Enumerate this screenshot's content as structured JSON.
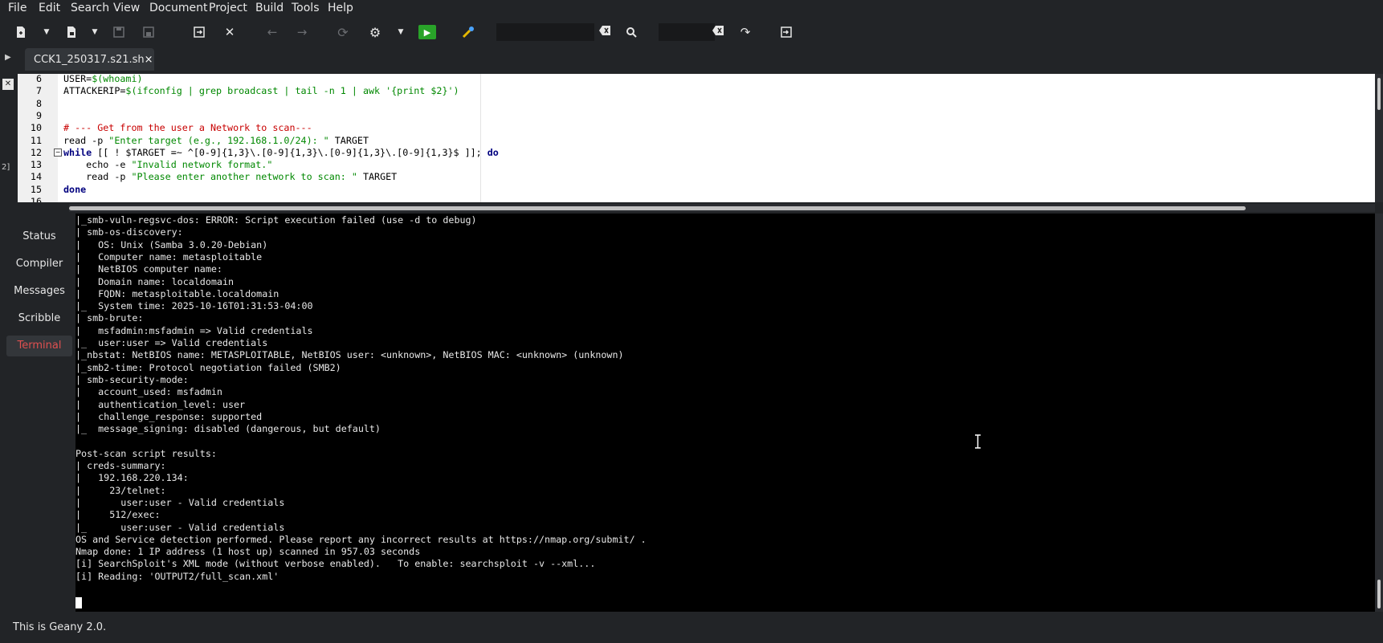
{
  "menu": [
    "File",
    "Edit",
    "Search",
    "View",
    "Document",
    "Project",
    "Build",
    "Tools",
    "Help"
  ],
  "toolbar": {
    "search_value": "",
    "goto_value": ""
  },
  "tab": {
    "label": "CCK1_250317.s21.sh",
    "close": "×"
  },
  "strip": {
    "num": "2]"
  },
  "editor": {
    "lines": [
      {
        "n": "6",
        "parts": [
          [
            "op",
            "USER="
          ],
          [
            "st",
            "$(whoami)"
          ]
        ]
      },
      {
        "n": "7",
        "parts": [
          [
            "op",
            "ATTACKERIP="
          ],
          [
            "st",
            "$(ifconfig | grep broadcast | tail -n 1 | awk '{print $2}')"
          ]
        ]
      },
      {
        "n": "8",
        "parts": []
      },
      {
        "n": "9",
        "parts": []
      },
      {
        "n": "10",
        "parts": [
          [
            "cm",
            "# --- Get from the user a Network to scan---"
          ]
        ]
      },
      {
        "n": "11",
        "parts": [
          [
            "op",
            "read -p "
          ],
          [
            "st",
            "\"Enter target (e.g., 192.168.1.0/24): \""
          ],
          [
            "op",
            " TARGET"
          ]
        ]
      },
      {
        "n": "12",
        "parts": [
          [
            "kw",
            "while"
          ],
          [
            "op",
            " [[ ! $TARGET =~ ^[0-9]{1,3}\\.[0-9]{1,3}\\.[0-9]{1,3}\\.[0-9]{1,3}$ ]]; "
          ],
          [
            "kw",
            "do"
          ]
        ]
      },
      {
        "n": "13",
        "parts": [
          [
            "op",
            "    echo -e "
          ],
          [
            "st",
            "\"Invalid network format.\""
          ]
        ]
      },
      {
        "n": "14",
        "parts": [
          [
            "op",
            "    read -p "
          ],
          [
            "st",
            "\"Please enter another network to scan: \""
          ],
          [
            "op",
            " TARGET"
          ]
        ]
      },
      {
        "n": "15",
        "parts": [
          [
            "kw",
            "done"
          ]
        ]
      },
      {
        "n": "16",
        "parts": []
      }
    ]
  },
  "sidepanel": {
    "tabs": [
      "Status",
      "Compiler",
      "Messages",
      "Scribble",
      "Terminal"
    ],
    "active": "Terminal"
  },
  "terminal": {
    "lines": [
      "|_smb-vuln-regsvc-dos: ERROR: Script execution failed (use -d to debug)",
      "| smb-os-discovery:",
      "|   OS: Unix (Samba 3.0.20-Debian)",
      "|   Computer name: metasploitable",
      "|   NetBIOS computer name:",
      "|   Domain name: localdomain",
      "|   FQDN: metasploitable.localdomain",
      "|_  System time: 2025-10-16T01:31:53-04:00",
      "| smb-brute:",
      "|   msfadmin:msfadmin => Valid credentials",
      "|_  user:user => Valid credentials",
      "|_nbstat: NetBIOS name: METASPLOITABLE, NetBIOS user: <unknown>, NetBIOS MAC: <unknown> (unknown)",
      "|_smb2-time: Protocol negotiation failed (SMB2)",
      "| smb-security-mode:",
      "|   account_used: msfadmin",
      "|   authentication_level: user",
      "|   challenge_response: supported",
      "|_  message_signing: disabled (dangerous, but default)",
      "",
      "Post-scan script results:",
      "| creds-summary:",
      "|   192.168.220.134:",
      "|     23/telnet:",
      "|       user:user - Valid credentials",
      "|     512/exec:",
      "|_      user:user - Valid credentials",
      "OS and Service detection performed. Please report any incorrect results at https://nmap.org/submit/ .",
      "Nmap done: 1 IP address (1 host up) scanned in 957.03 seconds",
      "[i] SearchSploit's XML mode (without verbose enabled).   To enable: searchsploit -v --xml...",
      "[i] Reading: 'OUTPUT2/full_scan.xml'"
    ]
  },
  "status": {
    "text": "This is Geany 2.0."
  }
}
